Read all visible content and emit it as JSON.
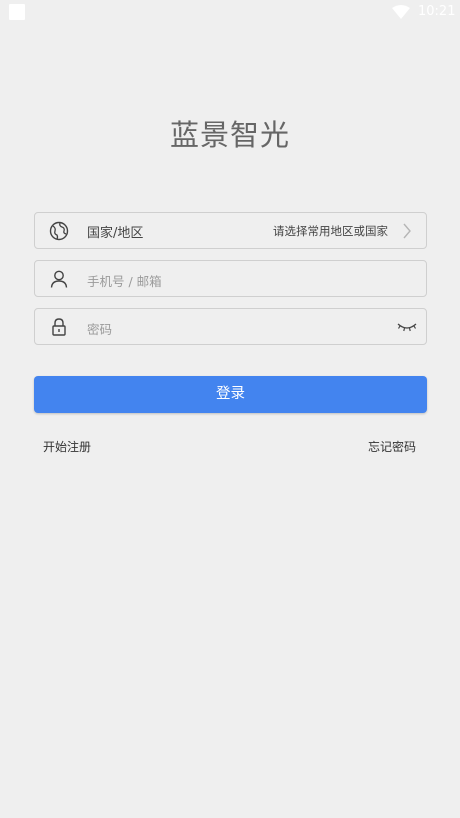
{
  "status": {
    "time": "10:21"
  },
  "app": {
    "title": "蓝景智光"
  },
  "form": {
    "region": {
      "label": "国家/地区",
      "value": "请选择常用地区或国家"
    },
    "account": {
      "placeholder": "手机号 / 邮箱"
    },
    "password": {
      "placeholder": "密码"
    },
    "login_label": "登录"
  },
  "links": {
    "register": "开始注册",
    "forgot": "忘记密码"
  },
  "colors": {
    "accent": "#4384ef",
    "background": "#efefef"
  }
}
